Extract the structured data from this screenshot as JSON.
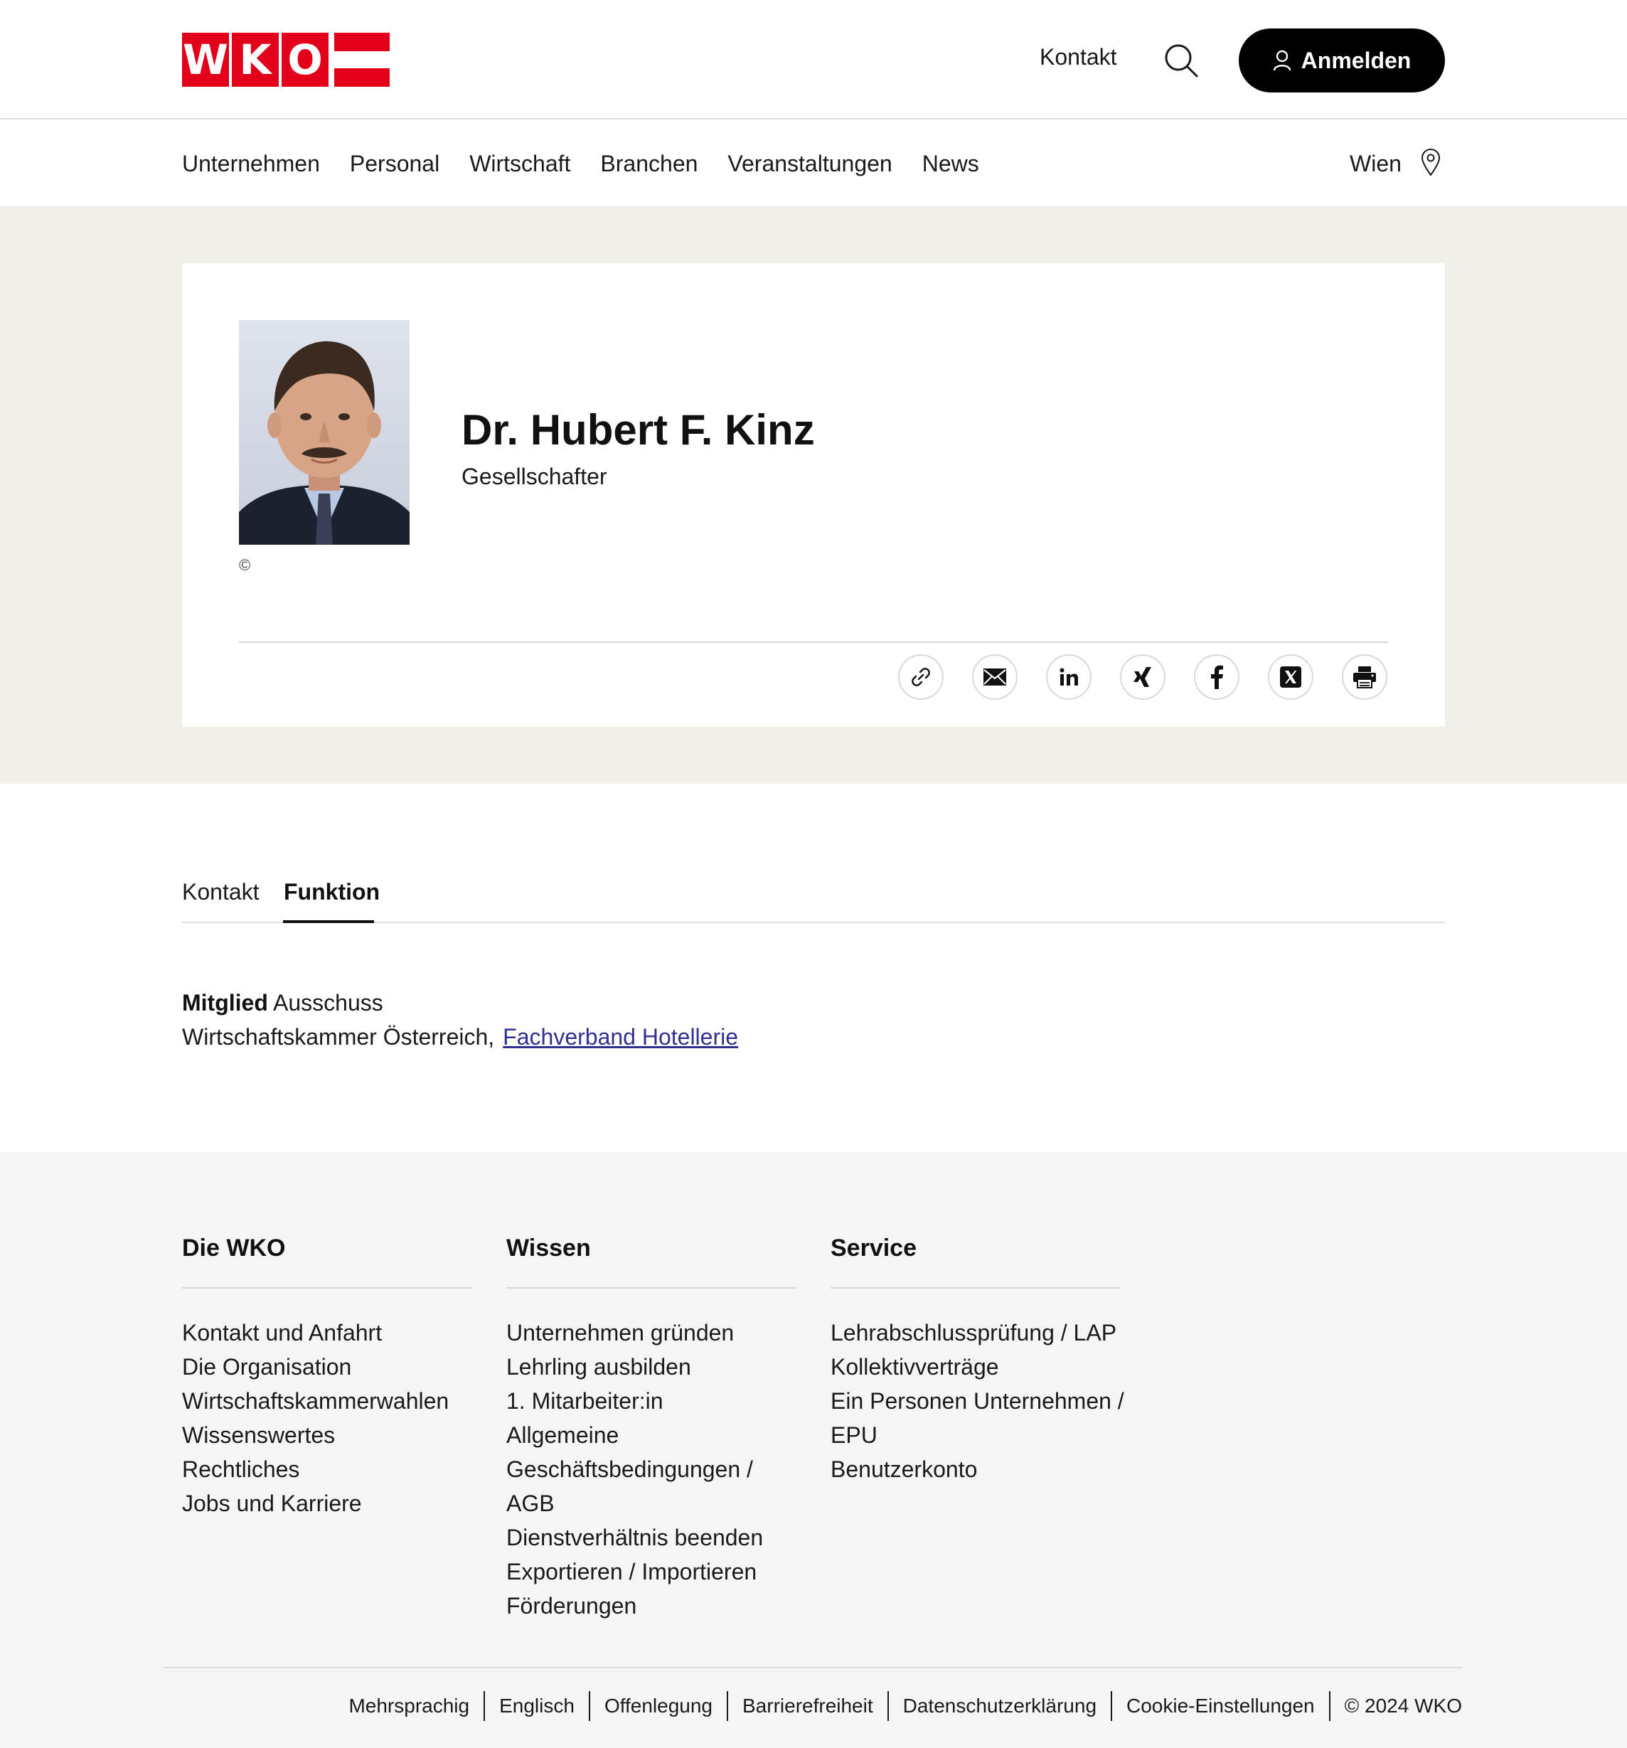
{
  "header": {
    "logo_letters": [
      "W",
      "K",
      "O"
    ],
    "contact_label": "Kontakt",
    "login_label": "Anmelden"
  },
  "nav": {
    "items": [
      "Unternehmen",
      "Personal",
      "Wirtschaft",
      "Branchen",
      "Veranstaltungen",
      "News"
    ],
    "region": "Wien"
  },
  "profile": {
    "name": "Dr. Hubert F. Kinz",
    "role": "Gesellschafter",
    "copyright": "©",
    "share_icons": [
      "link-icon",
      "mail-icon",
      "linkedin-icon",
      "xing-icon",
      "facebook-icon",
      "x-icon",
      "print-icon"
    ]
  },
  "tabs": {
    "kontakt": "Kontakt",
    "funktion": "Funktion",
    "active": "Funktion"
  },
  "function": {
    "title": "Mitglied",
    "committee": "Ausschuss",
    "org": "Wirtschaftskammer Österreich,",
    "link": "Fachverband Hotellerie"
  },
  "footer": {
    "columns": [
      {
        "title": "Die WKO",
        "items": [
          "Kontakt und Anfahrt",
          "Die Organisation",
          "Wirtschaftskammerwahlen",
          "Wissenswertes",
          "Rechtliches",
          "Jobs und Karriere"
        ]
      },
      {
        "title": "Wissen",
        "items": [
          "Unternehmen gründen",
          "Lehrling ausbilden",
          "1. Mitarbeiter:in",
          "Allgemeine Geschäftsbedingungen / AGB",
          "Dienstverhältnis beenden",
          "Exportieren / Importieren",
          "Förderungen"
        ]
      },
      {
        "title": "Service",
        "items": [
          "Lehrabschlussprüfung / LAP",
          "Kollektivverträge",
          "Ein Personen Unternehmen / EPU",
          "Benutzerkonto"
        ]
      }
    ],
    "legal": [
      "Mehrsprachig",
      "Englisch",
      "Offenlegung",
      "Barrierefreiheit",
      "Datenschutzerklärung",
      "Cookie-Einstellungen"
    ],
    "copyright": "© 2024 WKO"
  },
  "colors": {
    "brand_red": "#e2001a",
    "hero_bg": "#f0efea",
    "footer_bg": "#f5f5f5",
    "link": "#2e3192"
  }
}
